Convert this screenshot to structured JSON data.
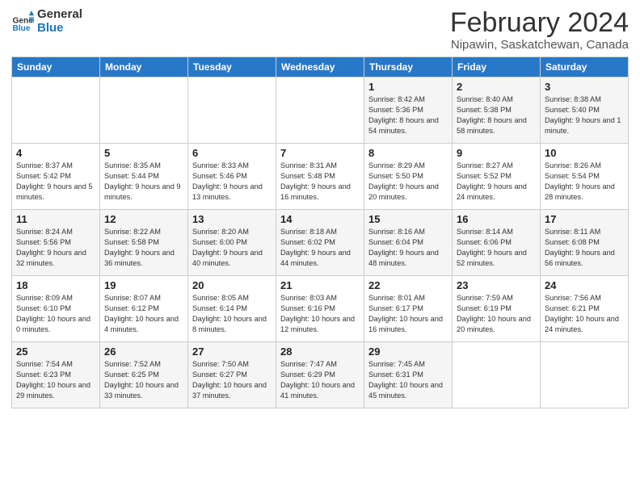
{
  "header": {
    "logo_line1": "General",
    "logo_line2": "Blue",
    "month": "February 2024",
    "location": "Nipawin, Saskatchewan, Canada"
  },
  "weekdays": [
    "Sunday",
    "Monday",
    "Tuesday",
    "Wednesday",
    "Thursday",
    "Friday",
    "Saturday"
  ],
  "weeks": [
    [
      {
        "day": "",
        "info": ""
      },
      {
        "day": "",
        "info": ""
      },
      {
        "day": "",
        "info": ""
      },
      {
        "day": "",
        "info": ""
      },
      {
        "day": "1",
        "info": "Sunrise: 8:42 AM\nSunset: 5:36 PM\nDaylight: 8 hours\nand 54 minutes."
      },
      {
        "day": "2",
        "info": "Sunrise: 8:40 AM\nSunset: 5:38 PM\nDaylight: 8 hours\nand 58 minutes."
      },
      {
        "day": "3",
        "info": "Sunrise: 8:38 AM\nSunset: 5:40 PM\nDaylight: 9 hours\nand 1 minute."
      }
    ],
    [
      {
        "day": "4",
        "info": "Sunrise: 8:37 AM\nSunset: 5:42 PM\nDaylight: 9 hours\nand 5 minutes."
      },
      {
        "day": "5",
        "info": "Sunrise: 8:35 AM\nSunset: 5:44 PM\nDaylight: 9 hours\nand 9 minutes."
      },
      {
        "day": "6",
        "info": "Sunrise: 8:33 AM\nSunset: 5:46 PM\nDaylight: 9 hours\nand 13 minutes."
      },
      {
        "day": "7",
        "info": "Sunrise: 8:31 AM\nSunset: 5:48 PM\nDaylight: 9 hours\nand 16 minutes."
      },
      {
        "day": "8",
        "info": "Sunrise: 8:29 AM\nSunset: 5:50 PM\nDaylight: 9 hours\nand 20 minutes."
      },
      {
        "day": "9",
        "info": "Sunrise: 8:27 AM\nSunset: 5:52 PM\nDaylight: 9 hours\nand 24 minutes."
      },
      {
        "day": "10",
        "info": "Sunrise: 8:26 AM\nSunset: 5:54 PM\nDaylight: 9 hours\nand 28 minutes."
      }
    ],
    [
      {
        "day": "11",
        "info": "Sunrise: 8:24 AM\nSunset: 5:56 PM\nDaylight: 9 hours\nand 32 minutes."
      },
      {
        "day": "12",
        "info": "Sunrise: 8:22 AM\nSunset: 5:58 PM\nDaylight: 9 hours\nand 36 minutes."
      },
      {
        "day": "13",
        "info": "Sunrise: 8:20 AM\nSunset: 6:00 PM\nDaylight: 9 hours\nand 40 minutes."
      },
      {
        "day": "14",
        "info": "Sunrise: 8:18 AM\nSunset: 6:02 PM\nDaylight: 9 hours\nand 44 minutes."
      },
      {
        "day": "15",
        "info": "Sunrise: 8:16 AM\nSunset: 6:04 PM\nDaylight: 9 hours\nand 48 minutes."
      },
      {
        "day": "16",
        "info": "Sunrise: 8:14 AM\nSunset: 6:06 PM\nDaylight: 9 hours\nand 52 minutes."
      },
      {
        "day": "17",
        "info": "Sunrise: 8:11 AM\nSunset: 6:08 PM\nDaylight: 9 hours\nand 56 minutes."
      }
    ],
    [
      {
        "day": "18",
        "info": "Sunrise: 8:09 AM\nSunset: 6:10 PM\nDaylight: 10 hours\nand 0 minutes."
      },
      {
        "day": "19",
        "info": "Sunrise: 8:07 AM\nSunset: 6:12 PM\nDaylight: 10 hours\nand 4 minutes."
      },
      {
        "day": "20",
        "info": "Sunrise: 8:05 AM\nSunset: 6:14 PM\nDaylight: 10 hours\nand 8 minutes."
      },
      {
        "day": "21",
        "info": "Sunrise: 8:03 AM\nSunset: 6:16 PM\nDaylight: 10 hours\nand 12 minutes."
      },
      {
        "day": "22",
        "info": "Sunrise: 8:01 AM\nSunset: 6:17 PM\nDaylight: 10 hours\nand 16 minutes."
      },
      {
        "day": "23",
        "info": "Sunrise: 7:59 AM\nSunset: 6:19 PM\nDaylight: 10 hours\nand 20 minutes."
      },
      {
        "day": "24",
        "info": "Sunrise: 7:56 AM\nSunset: 6:21 PM\nDaylight: 10 hours\nand 24 minutes."
      }
    ],
    [
      {
        "day": "25",
        "info": "Sunrise: 7:54 AM\nSunset: 6:23 PM\nDaylight: 10 hours\nand 29 minutes."
      },
      {
        "day": "26",
        "info": "Sunrise: 7:52 AM\nSunset: 6:25 PM\nDaylight: 10 hours\nand 33 minutes."
      },
      {
        "day": "27",
        "info": "Sunrise: 7:50 AM\nSunset: 6:27 PM\nDaylight: 10 hours\nand 37 minutes."
      },
      {
        "day": "28",
        "info": "Sunrise: 7:47 AM\nSunset: 6:29 PM\nDaylight: 10 hours\nand 41 minutes."
      },
      {
        "day": "29",
        "info": "Sunrise: 7:45 AM\nSunset: 6:31 PM\nDaylight: 10 hours\nand 45 minutes."
      },
      {
        "day": "",
        "info": ""
      },
      {
        "day": "",
        "info": ""
      }
    ]
  ]
}
